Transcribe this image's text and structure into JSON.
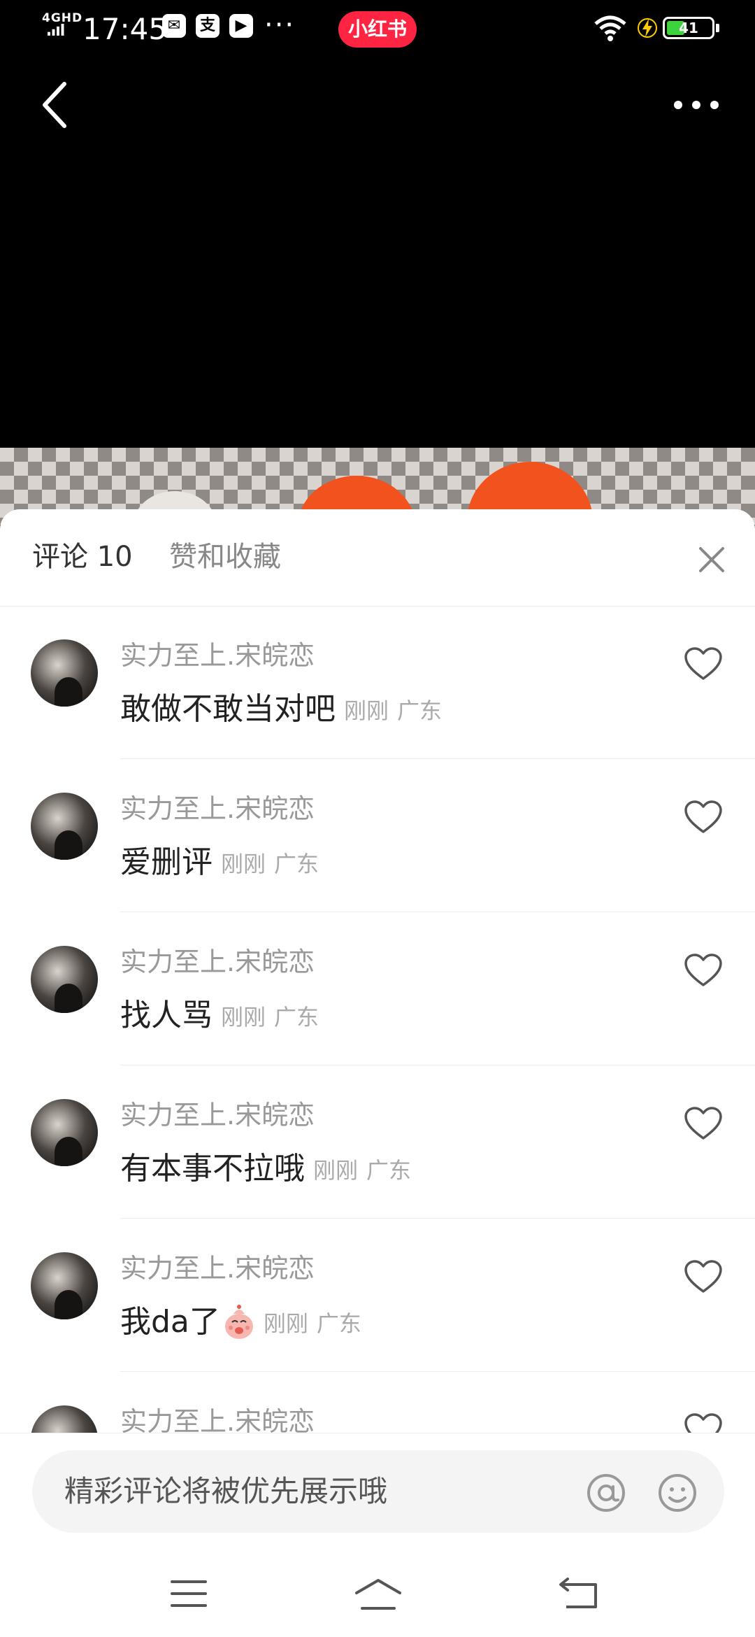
{
  "status_bar": {
    "network": "4GHD",
    "time": "17:45",
    "app_badge": "小红书",
    "battery": "41",
    "battery_level": 0.41
  },
  "tabs": {
    "comments": "评论 10",
    "likes_collections": "赞和收藏"
  },
  "comments": [
    {
      "user": "实力至上.宋皖恋",
      "text": "敢做不敢当对吧",
      "time": "刚刚",
      "location": "广东",
      "emoji": false
    },
    {
      "user": "实力至上.宋皖恋",
      "text": "爱删评",
      "time": "刚刚",
      "location": "广东",
      "emoji": false
    },
    {
      "user": "实力至上.宋皖恋",
      "text": "找人骂",
      "time": "刚刚",
      "location": "广东",
      "emoji": false
    },
    {
      "user": "实力至上.宋皖恋",
      "text": "有本事不拉哦",
      "time": "刚刚",
      "location": "广东",
      "emoji": false
    },
    {
      "user": "实力至上.宋皖恋",
      "text": "我da了",
      "time": "刚刚",
      "location": "广东",
      "emoji": true
    },
    {
      "user": "实力至上.宋皖恋",
      "text": "",
      "time": "",
      "location": "",
      "emoji": false
    }
  ],
  "input": {
    "placeholder": "精彩评论将被优先展示哦"
  },
  "colors": {
    "brand": "#ff2442",
    "battery": "#3dd33d"
  }
}
